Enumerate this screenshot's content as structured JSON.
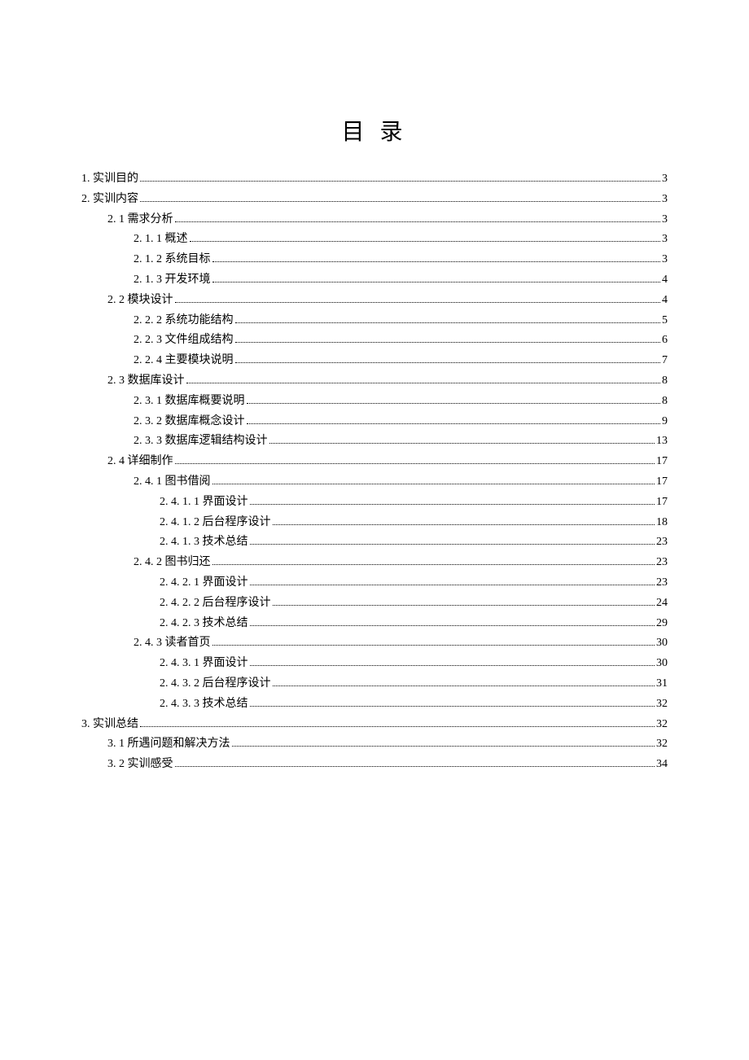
{
  "title": "目 录",
  "entries": [
    {
      "indent": 0,
      "label": "1. 实训目的",
      "page": "3"
    },
    {
      "indent": 0,
      "label": "2. 实训内容",
      "page": "3"
    },
    {
      "indent": 1,
      "label": "2. 1 需求分析",
      "page": "3"
    },
    {
      "indent": 2,
      "label": "2. 1. 1 概述",
      "page": "3"
    },
    {
      "indent": 2,
      "label": "2. 1. 2 系统目标",
      "page": "3"
    },
    {
      "indent": 2,
      "label": "2. 1. 3 开发环境",
      "page": "4"
    },
    {
      "indent": 1,
      "label": "2. 2 模块设计",
      "page": "4"
    },
    {
      "indent": 2,
      "label": "2. 2. 2 系统功能结构",
      "page": "5"
    },
    {
      "indent": 2,
      "label": "2. 2. 3 文件组成结构",
      "page": "6"
    },
    {
      "indent": 2,
      "label": "2. 2. 4 主要模块说明",
      "page": "7"
    },
    {
      "indent": 1,
      "label": "2. 3 数据库设计",
      "page": "8"
    },
    {
      "indent": 2,
      "label": "2. 3. 1 数据库概要说明",
      "page": "8"
    },
    {
      "indent": 2,
      "label": "2. 3. 2 数据库概念设计",
      "page": "9"
    },
    {
      "indent": 2,
      "label": "2. 3. 3 数据库逻辑结构设计",
      "page": "13"
    },
    {
      "indent": 1,
      "label": "2. 4 详细制作",
      "page": "17"
    },
    {
      "indent": 2,
      "label": "2. 4. 1 图书借阅",
      "page": "17"
    },
    {
      "indent": 3,
      "label": "2. 4. 1. 1 界面设计",
      "page": "17"
    },
    {
      "indent": 3,
      "label": "2. 4. 1. 2 后台程序设计",
      "page": "18"
    },
    {
      "indent": 3,
      "label": "2. 4. 1. 3 技术总结",
      "page": "23"
    },
    {
      "indent": 2,
      "label": "2. 4. 2 图书归还",
      "page": "23"
    },
    {
      "indent": 3,
      "label": "2. 4. 2. 1 界面设计",
      "page": "23"
    },
    {
      "indent": 3,
      "label": "2. 4. 2. 2 后台程序设计",
      "page": "24"
    },
    {
      "indent": 3,
      "label": "2. 4. 2. 3 技术总结",
      "page": "29"
    },
    {
      "indent": 2,
      "label": "2. 4. 3 读者首页",
      "page": "30"
    },
    {
      "indent": 3,
      "label": "2. 4. 3. 1 界面设计",
      "page": "30"
    },
    {
      "indent": 3,
      "label": "2. 4. 3. 2 后台程序设计",
      "page": "31"
    },
    {
      "indent": 3,
      "label": "2. 4. 3. 3 技术总结",
      "page": "32"
    },
    {
      "indent": 0,
      "label": "3. 实训总结",
      "page": "32"
    },
    {
      "indent": 1,
      "label": "3. 1 所遇问题和解决方法",
      "page": "32"
    },
    {
      "indent": 1,
      "label": "3. 2 实训感受",
      "page": "34"
    }
  ]
}
